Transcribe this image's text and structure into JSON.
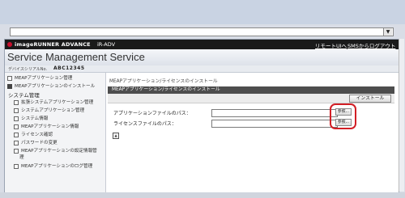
{
  "browser": {
    "dropdown_icon": "chevron-down-icon",
    "dropdown_glyph": "▼"
  },
  "header": {
    "brand": "imageRUNNER ADVANCE",
    "model": "iR-ADV",
    "portal_link": "リモートUIへ",
    "logout_link": "SMSからログアウト",
    "title": "Service Management Service",
    "serial_label": "デバイスシリアルNo.",
    "serial_value": "ABC12345"
  },
  "sidebar": {
    "items_top": [
      {
        "label": "MEAPアプリケーション管理"
      },
      {
        "label": "MEAPアプリケーションのインストール",
        "active": true
      }
    ],
    "section_title": "システム管理",
    "items_system": [
      {
        "label": "拡張システムアプリケーション管理"
      },
      {
        "label": "システムアプリケーション管理"
      },
      {
        "label": "システム情報"
      },
      {
        "label": "MEAPアプリケーション情報"
      },
      {
        "label": "ライセンス確認"
      },
      {
        "label": "パスワードの変更"
      },
      {
        "label": "MEAPアプリケーションの設定情報管"
      },
      {
        "label": "理"
      },
      {
        "label": "MEAPアプリケーションのログ管理"
      }
    ]
  },
  "main": {
    "breadcrumb": "MEAPアプリケーション/ライセンスのインストール",
    "panel_title": "MEAPアプリケーション/ライセンスのインストール",
    "install_button": "インストール",
    "app_path_label": "アプリケーションファイルのパス：",
    "license_path_label": "ライセンスファイルのパス：",
    "browse_label": "参照...",
    "app_path_value": "",
    "license_path_value": ""
  }
}
